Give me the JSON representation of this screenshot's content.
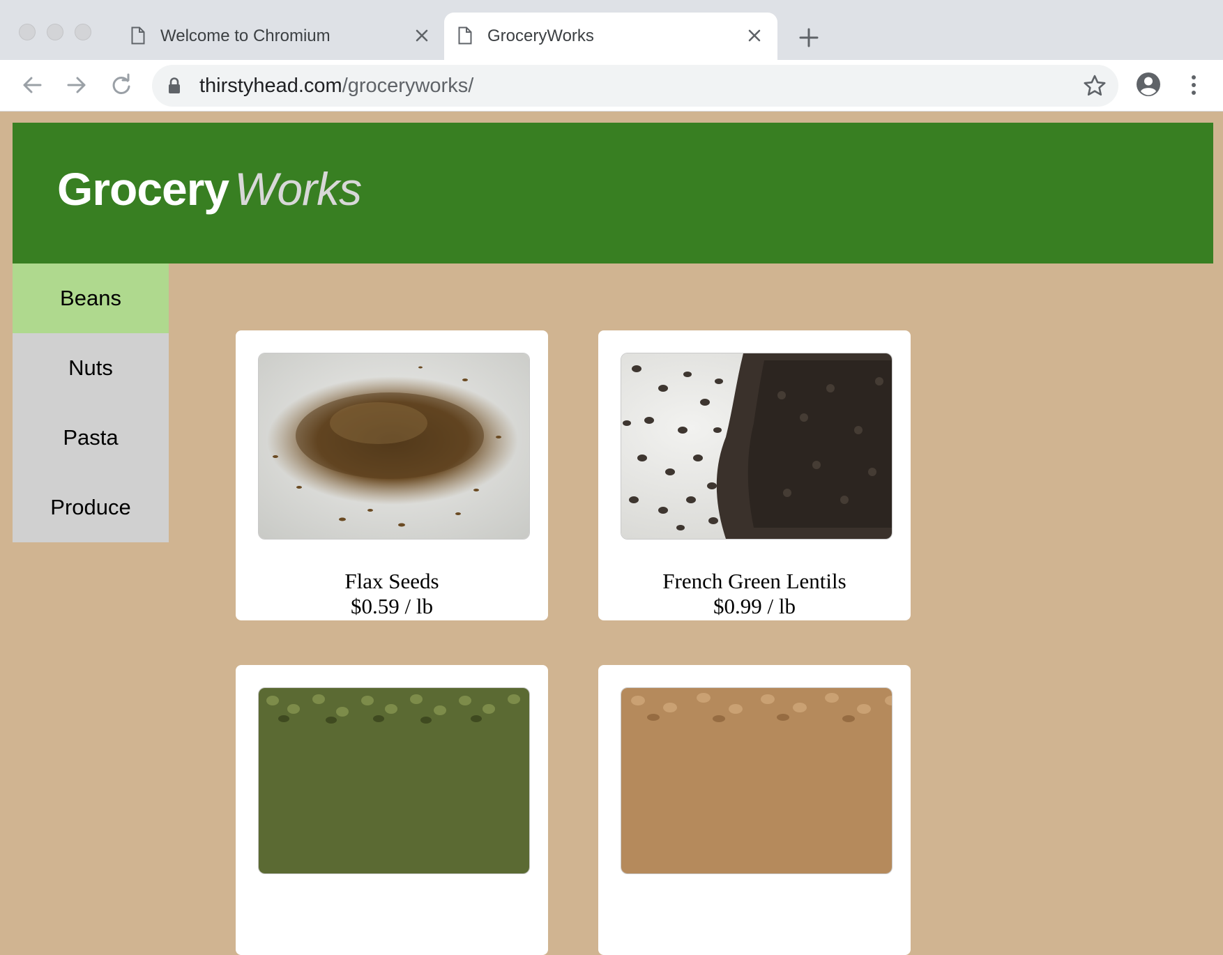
{
  "browser": {
    "tabs": [
      {
        "title": "Welcome to Chromium",
        "active": false
      },
      {
        "title": "GroceryWorks",
        "active": true
      }
    ],
    "address": {
      "host": "thirstyhead.com",
      "path": "/groceryworks/"
    }
  },
  "site": {
    "logo_bold": "Grocery",
    "logo_italic": "Works",
    "colors": {
      "header": "#387f22",
      "background": "#d0b491",
      "nav_active": "#afd98e",
      "nav_inactive": "#d0d0d0"
    }
  },
  "nav": {
    "items": [
      {
        "label": "Beans",
        "active": true
      },
      {
        "label": "Nuts",
        "active": false
      },
      {
        "label": "Pasta",
        "active": false
      },
      {
        "label": "Produce",
        "active": false
      }
    ]
  },
  "products": [
    {
      "name": "Flax Seeds",
      "price": "$0.59 / lb",
      "image": "flax-seeds-photo"
    },
    {
      "name": "French Green Lentils",
      "price": "$0.99 / lb",
      "image": "french-green-lentils-photo"
    },
    {
      "name": "",
      "price": "",
      "image": "green-split-peas-photo"
    },
    {
      "name": "",
      "price": "",
      "image": "brown-lentils-photo"
    }
  ]
}
